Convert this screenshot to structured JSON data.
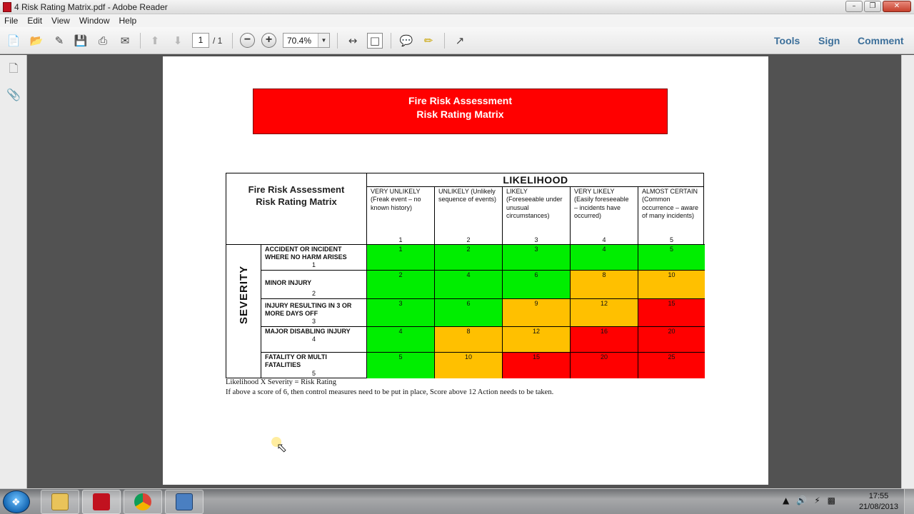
{
  "window": {
    "title": "4 Risk Rating Matrix.pdf - Adobe Reader"
  },
  "menu": [
    "File",
    "Edit",
    "View",
    "Window",
    "Help"
  ],
  "toolbar": {
    "page_current": "1",
    "page_total": "/ 1",
    "zoom": "70.4%",
    "tools_label": "Tools",
    "sign_label": "Sign",
    "comment_label": "Comment"
  },
  "document": {
    "banner_line1": "Fire Risk Assessment",
    "banner_line2": "Risk Rating Matrix",
    "corner_line1": "Fire Risk Assessment",
    "corner_line2": "Risk Rating Matrix",
    "likelihood_header": "LIKELIHOOD",
    "severity_header": "SEVERITY",
    "likelihood": [
      {
        "label": "VERY UNLIKELY (Freak event – no known history)",
        "num": "1"
      },
      {
        "label": "UNLIKELY (Unlikely sequence of events)",
        "num": "2"
      },
      {
        "label": "LIKELY (Foreseeable under unusual circumstances)",
        "num": "3"
      },
      {
        "label": "VERY LIKELY (Easily foreseeable – incidents have occurred)",
        "num": "4"
      },
      {
        "label": "ALMOST CERTAIN (Common occurrence – aware of many incidents)",
        "num": "5"
      }
    ],
    "severity": [
      {
        "label": "ACCIDENT OR INCIDENT WHERE NO HARM ARISES",
        "num": "1"
      },
      {
        "label": "MINOR INJURY",
        "num": "2"
      },
      {
        "label": "INJURY RESULTING IN 3 OR MORE DAYS OFF",
        "num": "3"
      },
      {
        "label": "MAJOR DISABLING INJURY",
        "num": "4"
      },
      {
        "label": "FATALITY OR MULTI FATALITIES",
        "num": "5"
      }
    ],
    "matrix": [
      [
        "1",
        "2",
        "3",
        "4",
        "5"
      ],
      [
        "2",
        "4",
        "6",
        "8",
        "10"
      ],
      [
        "3",
        "6",
        "9",
        "12",
        "15"
      ],
      [
        "4",
        "8",
        "12",
        "16",
        "20"
      ],
      [
        "5",
        "10",
        "15",
        "20",
        "25"
      ]
    ],
    "colors": {
      "green": "#00ee00",
      "amber": "#ffc000",
      "red": "#ff0000"
    },
    "footnote1": "Likelihood X Severity = Risk Rating",
    "footnote2": "If above a score of 6, then control measures need to be put in place, Score above 12 Action needs to be taken."
  },
  "taskbar": {
    "time": "17:55",
    "date": "21/08/2013"
  }
}
